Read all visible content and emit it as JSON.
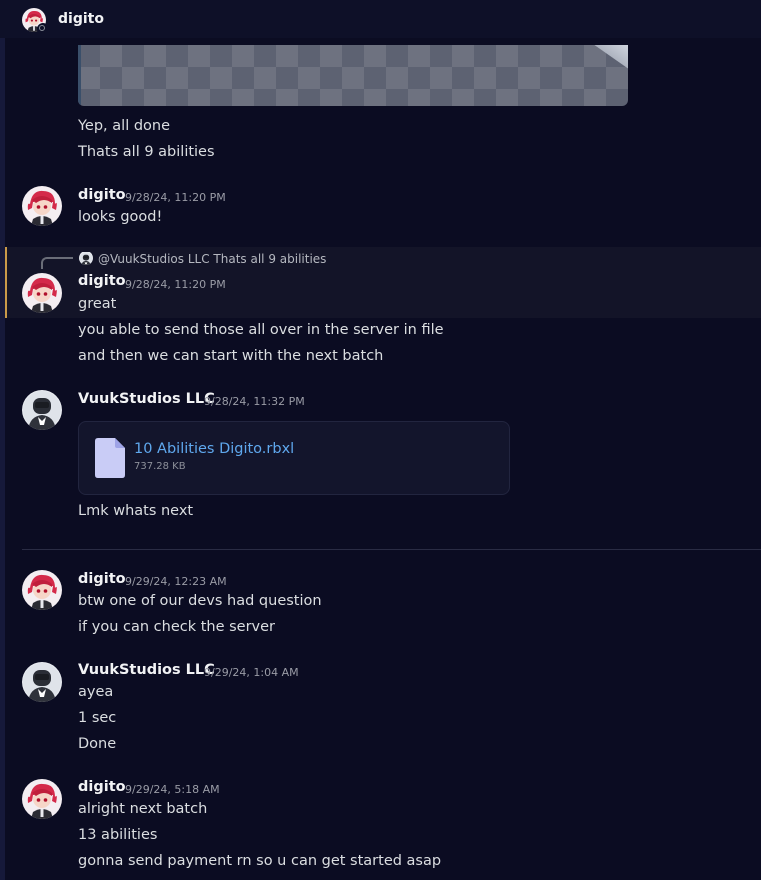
{
  "header": {
    "username": "digito"
  },
  "messages": {
    "m0": {
      "lines": [
        "Yep, all done",
        "Thats all 9 abilities"
      ]
    },
    "m1": {
      "username": "digito",
      "timestamp": "9/28/24, 11:20 PM",
      "lines": [
        "looks good!"
      ]
    },
    "m2": {
      "reply_mention": "@VuukStudios LLC",
      "reply_text": "Thats all 9 abilities",
      "username": "digito",
      "timestamp": "9/28/24, 11:20 PM",
      "lines": [
        "great",
        "you able to send those all over in the server in file",
        "and then we can start with the next batch"
      ]
    },
    "m3": {
      "username": "VuukStudios LLC",
      "timestamp": "9/28/24, 11:32 PM",
      "attachment": {
        "name": "10 Abilities Digito.rbxl",
        "size": "737.28 KB"
      },
      "lines": [
        "Lmk whats next"
      ]
    },
    "m4": {
      "username": "digito",
      "timestamp": "9/29/24, 12:23 AM",
      "lines": [
        "btw one of our devs had question",
        "if you can check the server"
      ]
    },
    "m5": {
      "username": "VuukStudios LLC",
      "timestamp": "9/29/24, 1:04 AM",
      "lines": [
        "ayea",
        "1 sec",
        "Done"
      ]
    },
    "m6": {
      "username": "digito",
      "timestamp": "9/29/24, 5:18 AM",
      "lines": [
        "alright next batch",
        "13 abilities",
        "gonna send payment rn so u can get started asap"
      ]
    }
  },
  "colors": {
    "background": "#0b0c22",
    "link": "#5fa8ee",
    "reply_highlight": "#c99a49"
  }
}
